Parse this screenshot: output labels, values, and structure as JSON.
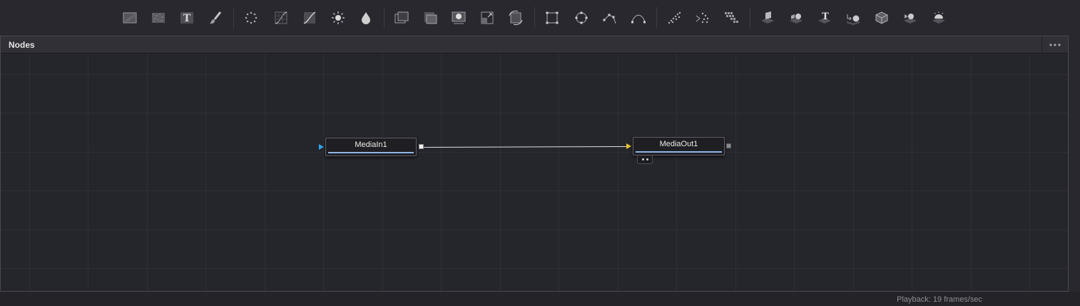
{
  "toolbar": {
    "tools": [
      {
        "icon": "background-icon"
      },
      {
        "icon": "fast-noise-icon"
      },
      {
        "icon": "text-icon",
        "glyph": "T"
      },
      {
        "icon": "paint-icon"
      },
      {
        "icon": "blur-icon"
      },
      {
        "icon": "color-curves-icon"
      },
      {
        "icon": "color-corrector-icon"
      },
      {
        "icon": "glow-icon"
      },
      {
        "icon": "color-droplet-icon"
      },
      {
        "icon": "merge-icon"
      },
      {
        "icon": "channel-boolean-icon"
      },
      {
        "icon": "matte-control-icon"
      },
      {
        "icon": "resize-icon"
      },
      {
        "icon": "transform-icon"
      },
      {
        "icon": "rectangle-mask-icon"
      },
      {
        "icon": "ellipse-mask-icon"
      },
      {
        "icon": "polygon-mask-icon"
      },
      {
        "icon": "bspline-mask-icon"
      },
      {
        "icon": "particle-emitter-icon"
      },
      {
        "icon": "particle-render-icon"
      },
      {
        "icon": "particle-grid-icon"
      },
      {
        "icon": "image-plane-3d-icon"
      },
      {
        "icon": "shape-3d-icon"
      },
      {
        "icon": "text-3d-icon",
        "glyph": "T"
      },
      {
        "icon": "merge-3d-icon"
      },
      {
        "icon": "renderer-3d-icon"
      },
      {
        "icon": "camera-3d-icon"
      },
      {
        "icon": "spotlight-3d-icon"
      }
    ]
  },
  "panel": {
    "title": "Nodes"
  },
  "nodes": [
    {
      "name": "MediaIn1"
    },
    {
      "name": "MediaOut1"
    }
  ],
  "colors": {
    "input_port_media_in": "#2fa3e8",
    "input_port_media_out": "#e8c22a",
    "node_bar": "#8fb6e6",
    "connection_line": "#e0e0e0"
  },
  "status": {
    "playback": "Playback: 19 frames/sec"
  }
}
